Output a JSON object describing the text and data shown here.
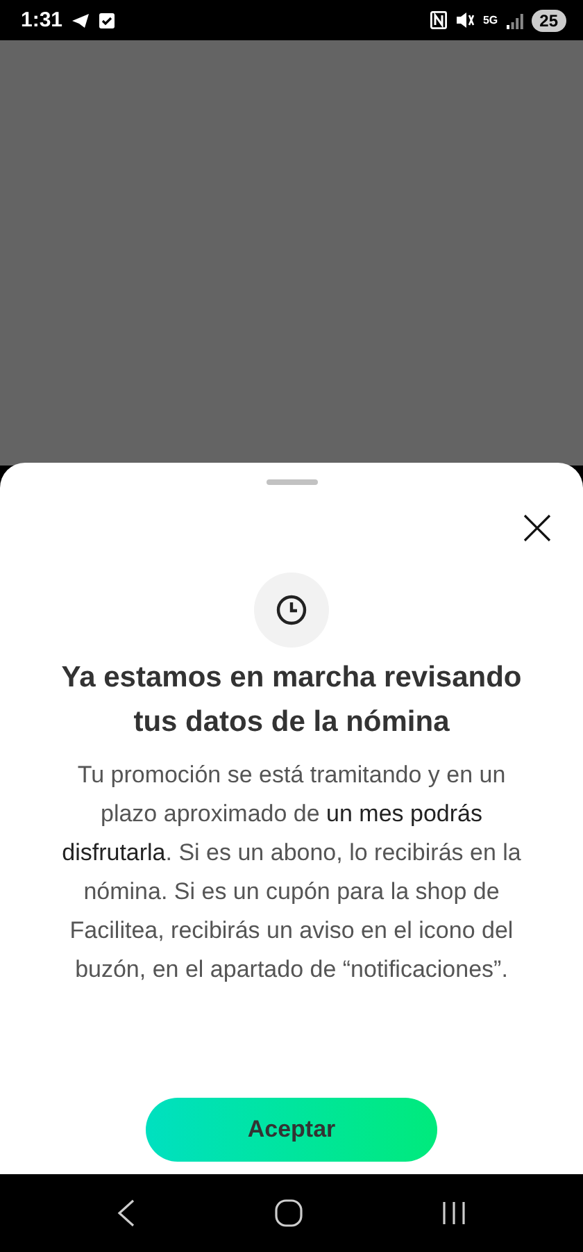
{
  "status_bar": {
    "time": "1:31",
    "network_type": "5G",
    "battery": "25"
  },
  "sheet": {
    "title": "Ya estamos en marcha revisando tus datos de la nómina",
    "body": "Tu promoción se está tramitando y en un plazo aproximado de **un mes podrás disfrutarla**. Si es un abono, lo recibirás en la nómina. Si es un cupón para la shop de Facilitea, recibirás un aviso en el icono del buzón, en el apartado de “notificaciones”.",
    "button": "Aceptar"
  }
}
